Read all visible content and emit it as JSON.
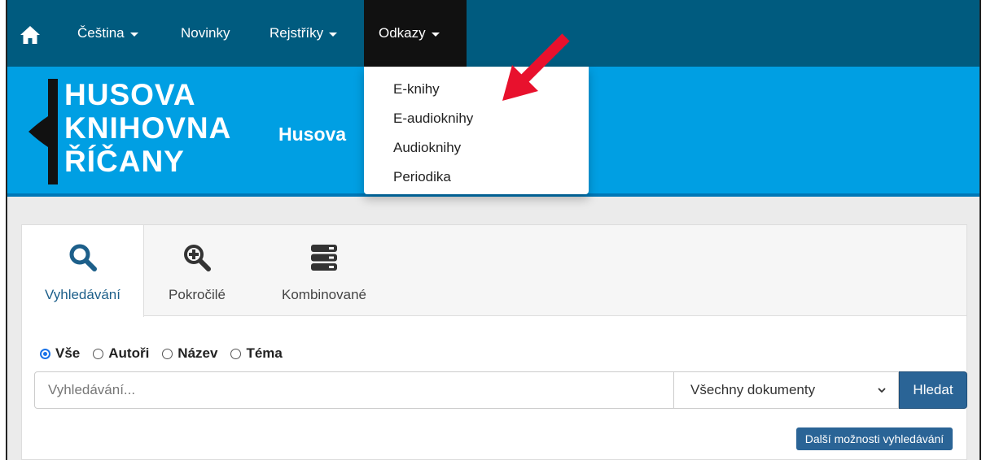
{
  "nav": {
    "home_icon": "home-icon",
    "items": [
      {
        "label": "Čeština",
        "has_caret": true
      },
      {
        "label": "Novinky",
        "has_caret": false
      },
      {
        "label": "Rejstříky",
        "has_caret": true
      },
      {
        "label": "Odkazy",
        "has_caret": true
      }
    ]
  },
  "banner": {
    "logo_lines": [
      "HUSOVA",
      "KNIHOVNA",
      "ŘÍČANY"
    ],
    "title": "Husova"
  },
  "dropdown": {
    "items": [
      "E-knihy",
      "E-audioknihy",
      "Audioknihy",
      "Periodika"
    ]
  },
  "search": {
    "tabs": [
      {
        "label": "Vyhledávání",
        "icon": "search-icon"
      },
      {
        "label": "Pokročilé",
        "icon": "zoom-in-icon"
      },
      {
        "label": "Kombinované",
        "icon": "server-stack-icon"
      }
    ],
    "radios": [
      {
        "label": "Vše",
        "checked": true
      },
      {
        "label": "Autoři",
        "checked": false
      },
      {
        "label": "Název",
        "checked": false
      },
      {
        "label": "Téma",
        "checked": false
      }
    ],
    "placeholder": "Vyhledávání...",
    "select_value": "Všechny dokumenty",
    "button_label": "Hledat",
    "more_label": "Další možnosti vyhledávání"
  },
  "colors": {
    "nav_bg": "#005b7f",
    "banner_bg": "#009fe3",
    "button_bg": "#2a6496",
    "arrow": "#e8112d"
  }
}
